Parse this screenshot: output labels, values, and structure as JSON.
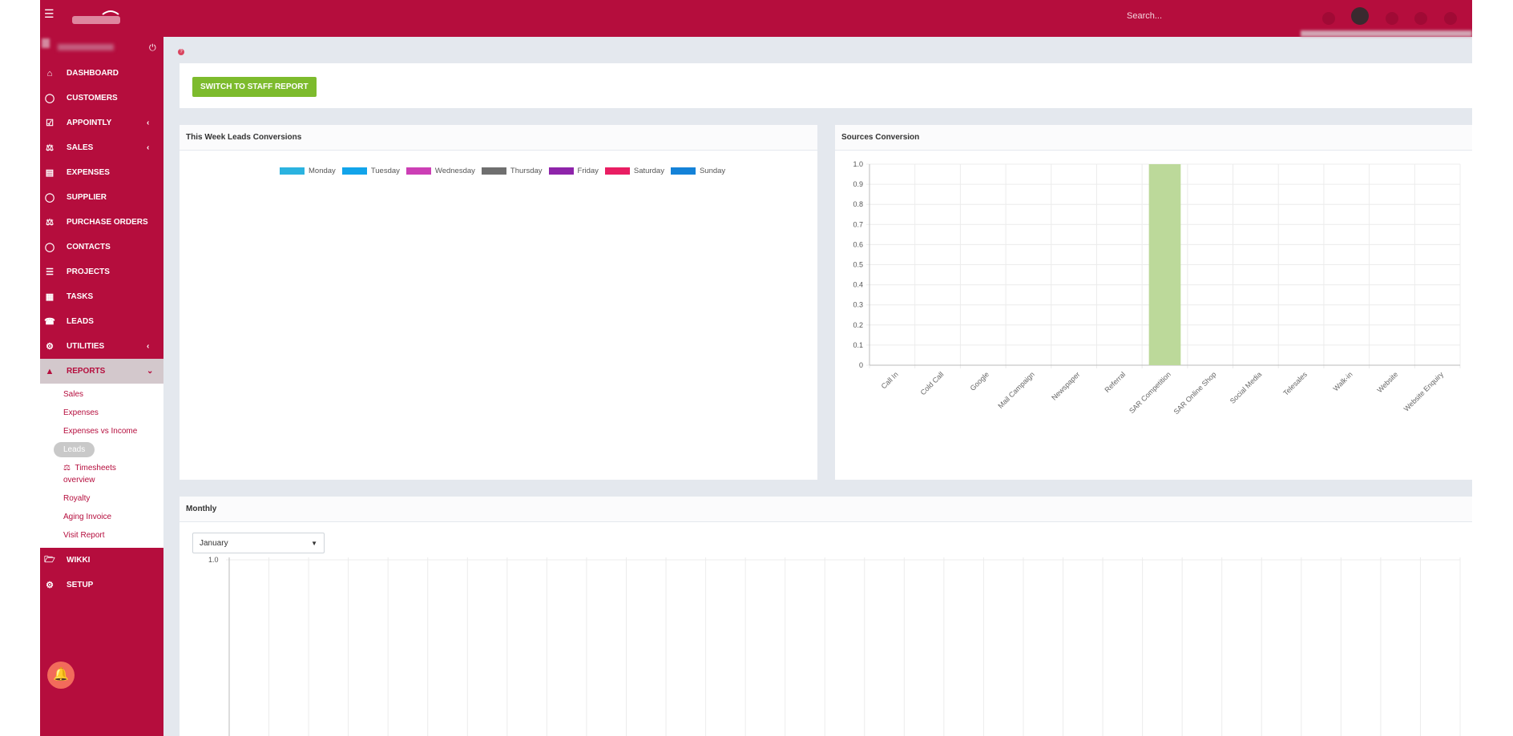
{
  "topbar": {
    "search_placeholder": "Search..."
  },
  "sidebar": {
    "items": [
      {
        "label": "DASHBOARD",
        "icon": "home-icon"
      },
      {
        "label": "CUSTOMERS",
        "icon": "user-icon"
      },
      {
        "label": "APPOINTLY",
        "icon": "calendar-check-icon",
        "chevron": "‹"
      },
      {
        "label": "SALES",
        "icon": "balance-scale-icon",
        "chevron": "‹"
      },
      {
        "label": "EXPENSES",
        "icon": "file-icon"
      },
      {
        "label": "SUPPLIER",
        "icon": "user-icon"
      },
      {
        "label": "PURCHASE ORDERS",
        "icon": "balance-scale-icon"
      },
      {
        "label": "CONTACTS",
        "icon": "user-icon"
      },
      {
        "label": "PROJECTS",
        "icon": "bars-icon"
      },
      {
        "label": "TASKS",
        "icon": "tasks-icon"
      },
      {
        "label": "LEADS",
        "icon": "tty-icon"
      },
      {
        "label": "UTILITIES",
        "icon": "cogs-icon",
        "chevron": "‹"
      },
      {
        "label": "REPORTS",
        "icon": "area-chart-icon",
        "chevron": "⌄"
      }
    ],
    "reports_sub": [
      "Sales",
      "Expenses",
      "Expenses vs Income",
      "Leads",
      "Timesheets overview",
      "Royalty",
      "Aging Invoice",
      "Visit Report"
    ],
    "bottom_items": [
      {
        "label": "WIKKI",
        "icon": "folder-open-icon"
      },
      {
        "label": "SETUP",
        "icon": "gear-icon"
      }
    ]
  },
  "top_panel": {
    "button_label": "SWITCH TO STAFF REPORT"
  },
  "leads_panel": {
    "title": "This Week Leads Conversions",
    "legend": [
      {
        "label": "Monday",
        "color": "#2bb3e0"
      },
      {
        "label": "Tuesday",
        "color": "#12a4ea"
      },
      {
        "label": "Wednesday",
        "color": "#cc3fb5"
      },
      {
        "label": "Thursday",
        "color": "#6f6f6f"
      },
      {
        "label": "Friday",
        "color": "#8e24aa"
      },
      {
        "label": "Saturday",
        "color": "#e91e63"
      },
      {
        "label": "Sunday",
        "color": "#1482d8"
      }
    ]
  },
  "sources_panel": {
    "title": "Sources Conversion"
  },
  "monthly_panel": {
    "title": "Monthly",
    "selected_month": "January",
    "y_top_label": "1.0"
  },
  "chart_data": [
    {
      "type": "bar",
      "title": "Sources Conversion",
      "categories": [
        "Call In",
        "Cold Call",
        "Google",
        "Mail Campaign",
        "Newspaper",
        "Referral",
        "SAR Competition",
        "SAR Online Shop",
        "Social Media",
        "Telesales",
        "Walk-in",
        "Website",
        "Website Enquiry"
      ],
      "values": [
        0,
        0,
        0,
        0,
        0,
        0,
        1,
        0,
        0,
        0,
        0,
        0,
        0
      ],
      "yticks": [
        "0",
        "0.1",
        "0.2",
        "0.3",
        "0.4",
        "0.5",
        "0.6",
        "0.7",
        "0.8",
        "0.9",
        "1.0"
      ],
      "ylim": [
        0,
        1
      ],
      "bar_color": "#bcd99a",
      "grid": true
    }
  ]
}
